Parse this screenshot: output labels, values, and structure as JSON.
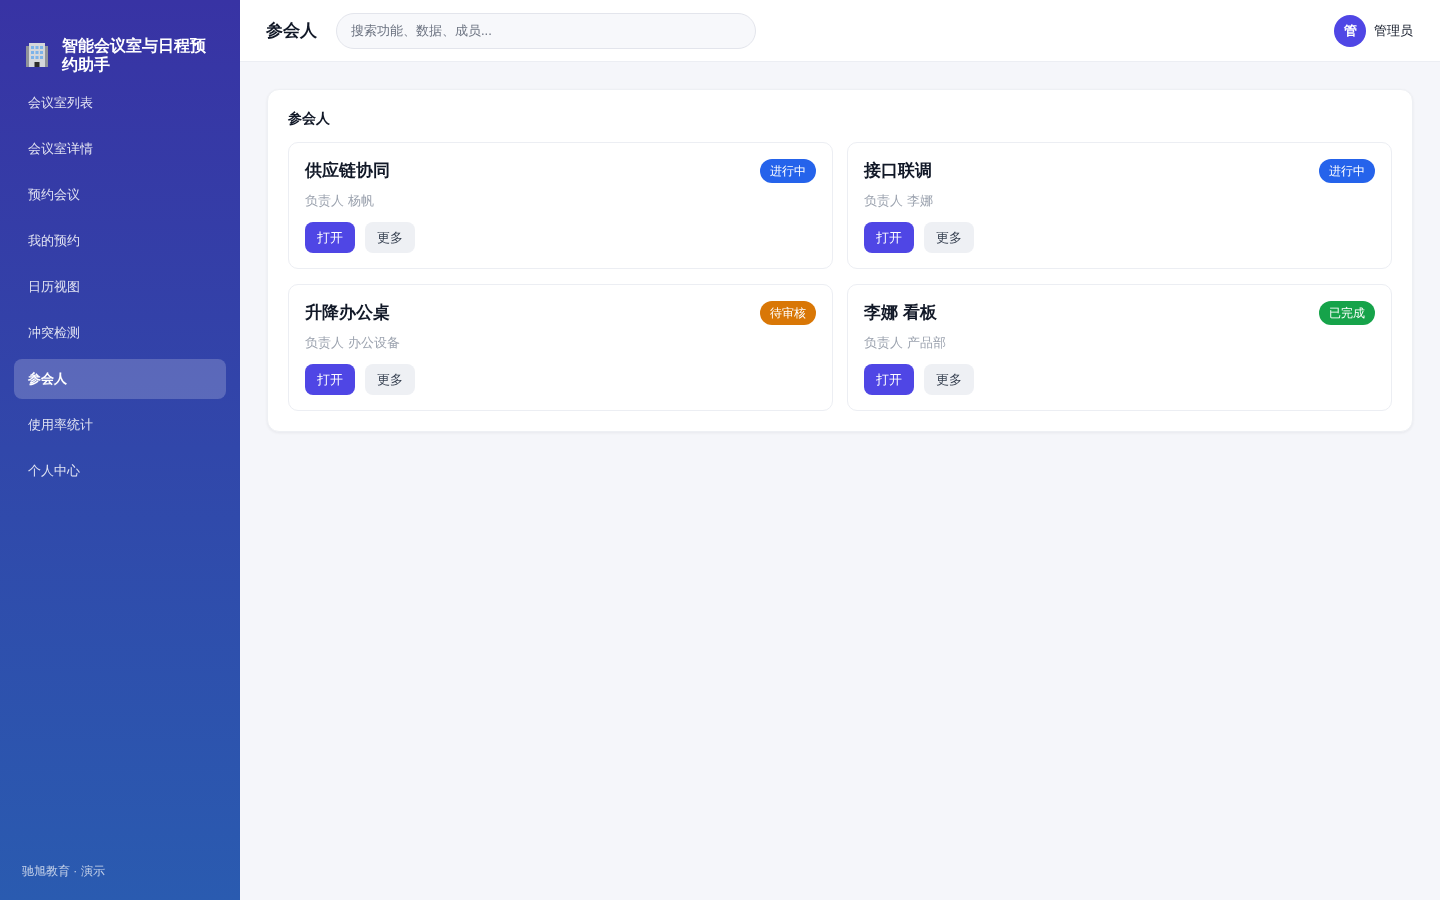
{
  "sidebar": {
    "brand": "智能会议室与日程预约助手",
    "items": [
      {
        "label": "会议室列表",
        "selected": false
      },
      {
        "label": "会议室详情",
        "selected": false
      },
      {
        "label": "预约会议",
        "selected": false
      },
      {
        "label": "我的预约",
        "selected": false
      },
      {
        "label": "日历视图",
        "selected": false
      },
      {
        "label": "冲突检测",
        "selected": false
      },
      {
        "label": "参会人",
        "selected": true
      },
      {
        "label": "使用率统计",
        "selected": false
      },
      {
        "label": "个人中心",
        "selected": false
      }
    ],
    "footer": "驰旭教育 · 演示"
  },
  "topbar": {
    "title": "参会人",
    "search": {
      "placeholder": "搜索功能、数据、成员..."
    },
    "user": {
      "avatar": "管",
      "name": "管理员"
    }
  },
  "panel": {
    "title": "参会人",
    "cards": [
      {
        "title": "供应链协同",
        "status": {
          "label": "进行中",
          "color": "#2563eb"
        },
        "owner": "负责人 杨帆",
        "actions": [
          {
            "label": "打开",
            "kind": "primary"
          },
          {
            "label": "更多",
            "kind": "secondary"
          }
        ]
      },
      {
        "title": "接口联调",
        "status": {
          "label": "进行中",
          "color": "#2563eb"
        },
        "owner": "负责人 李娜",
        "actions": [
          {
            "label": "打开",
            "kind": "primary"
          },
          {
            "label": "更多",
            "kind": "secondary"
          }
        ]
      },
      {
        "title": "升降办公桌",
        "status": {
          "label": "待审核",
          "color": "#d97706"
        },
        "owner": "负责人 办公设备",
        "actions": [
          {
            "label": "打开",
            "kind": "primary"
          },
          {
            "label": "更多",
            "kind": "secondary"
          }
        ]
      },
      {
        "title": "李娜 看板",
        "status": {
          "label": "已完成",
          "color": "#16a34a"
        },
        "owner": "负责人 产品部",
        "actions": [
          {
            "label": "打开",
            "kind": "primary"
          },
          {
            "label": "更多",
            "kind": "secondary"
          }
        ]
      }
    ]
  }
}
